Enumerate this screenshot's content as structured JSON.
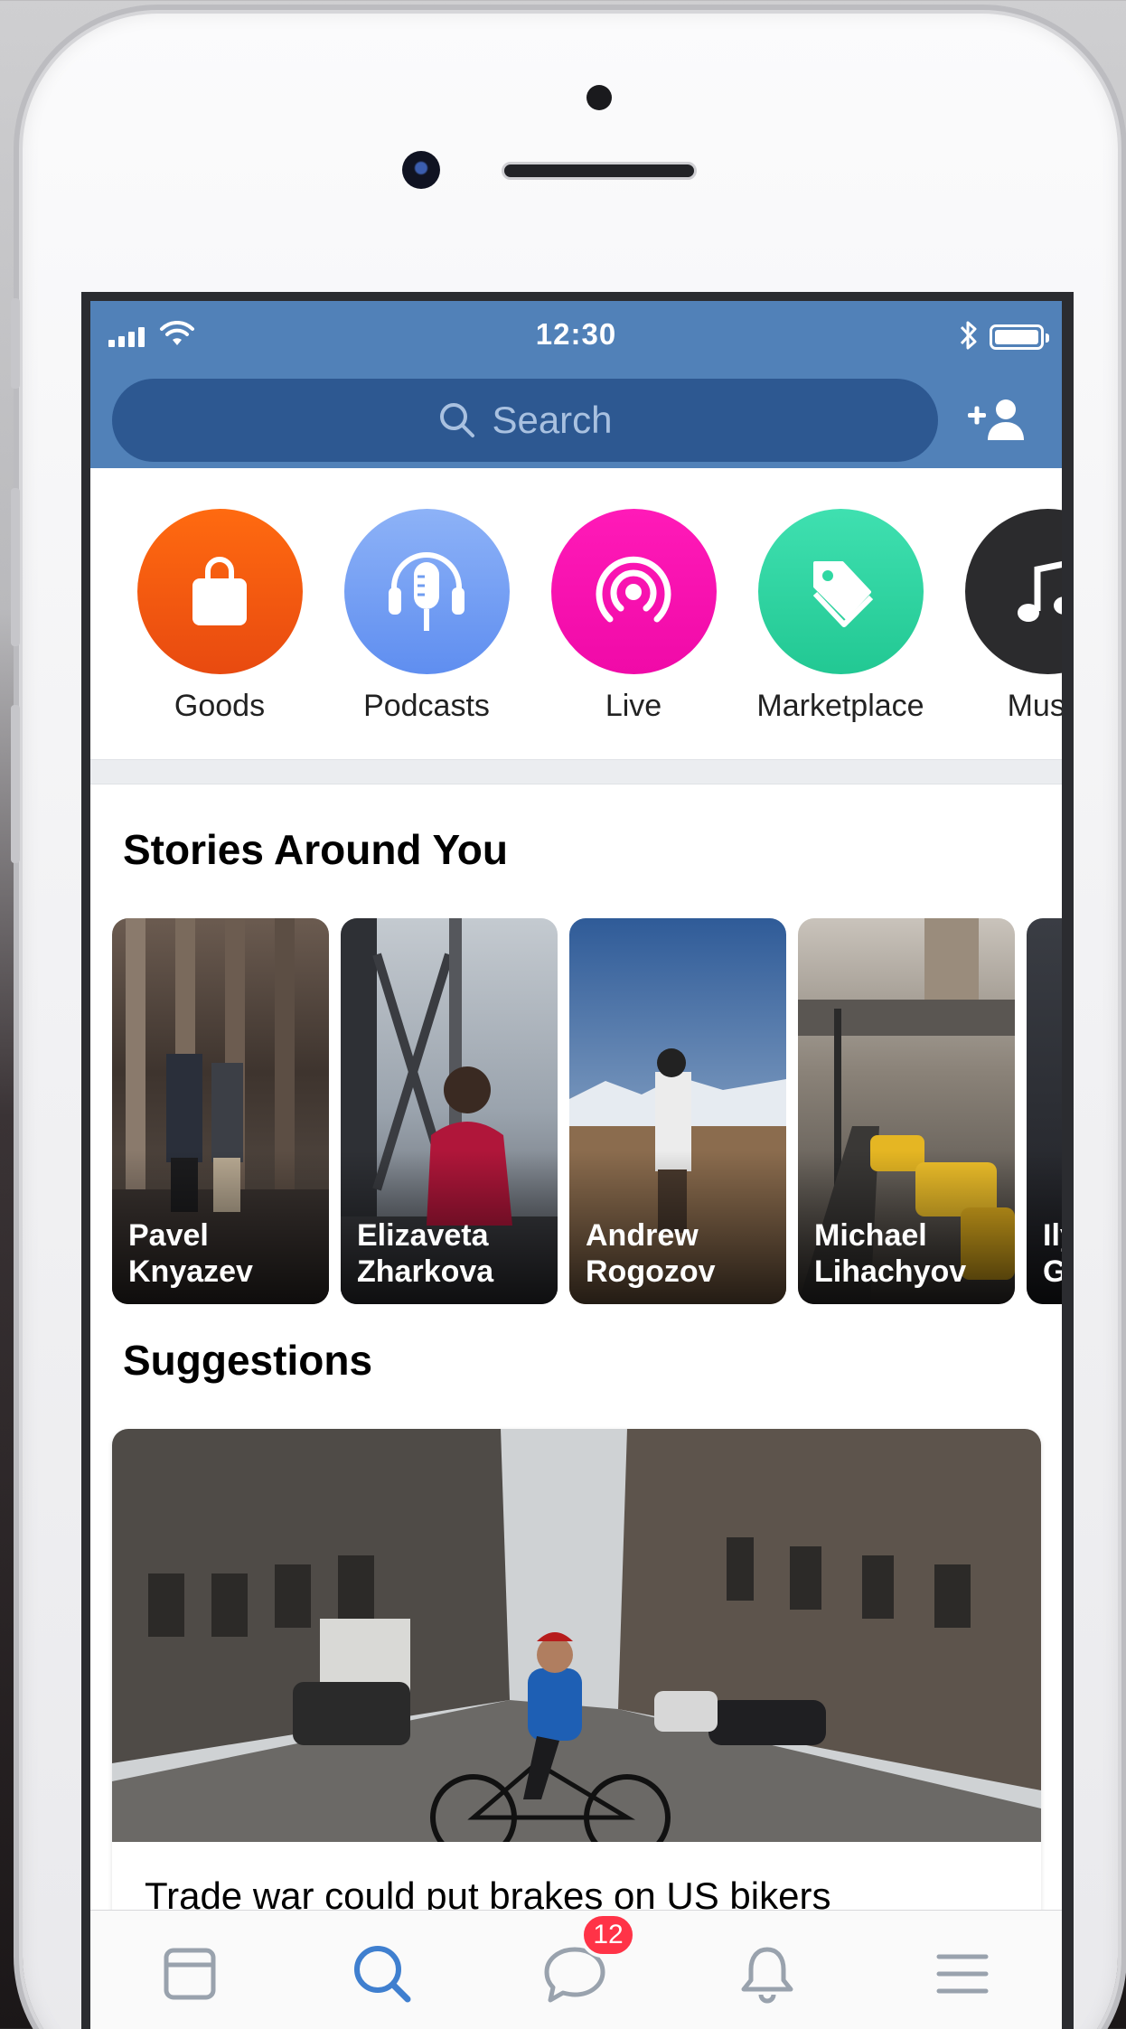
{
  "status_bar": {
    "time": "12:30"
  },
  "search": {
    "placeholder": "Search"
  },
  "services": [
    {
      "label": "Goods",
      "icon": "shopping-bag-icon",
      "color": "#f25a0f"
    },
    {
      "label": "Podcasts",
      "icon": "podcast-microphone-icon",
      "color": "#6f9cf0"
    },
    {
      "label": "Live",
      "icon": "live-broadcast-icon",
      "color": "#ff0fb3"
    },
    {
      "label": "Marketplace",
      "icon": "price-tag-icon",
      "color": "#2fd8a2"
    },
    {
      "label": "Music",
      "icon": "music-note-icon",
      "color": "#2a2a2a"
    }
  ],
  "stories_section": {
    "title": "Stories Around You",
    "items": [
      {
        "first": "Pavel",
        "last": "Knyazev"
      },
      {
        "first": "Elizaveta",
        "last": "Zharkova"
      },
      {
        "first": "Andrew",
        "last": "Rogozov"
      },
      {
        "first": "Michael",
        "last": "Lihachyov"
      },
      {
        "first": "Ily",
        "last": "G"
      }
    ]
  },
  "suggestions_section": {
    "title": "Suggestions",
    "card": {
      "headline": "Trade war could put brakes on US bikers"
    }
  },
  "tabbar": {
    "tabs": [
      {
        "name": "news",
        "icon": "newsfeed-icon"
      },
      {
        "name": "search",
        "icon": "search-icon",
        "active": true
      },
      {
        "name": "messages",
        "icon": "messages-icon",
        "badge": "12"
      },
      {
        "name": "notifications",
        "icon": "bell-icon"
      },
      {
        "name": "menu",
        "icon": "menu-icon"
      }
    ],
    "messages_badge": "12"
  },
  "colors": {
    "header": "#5181b8",
    "search_bg": "#2d5891",
    "active_tab": "#3f7fcf",
    "badge": "#ff3347"
  }
}
